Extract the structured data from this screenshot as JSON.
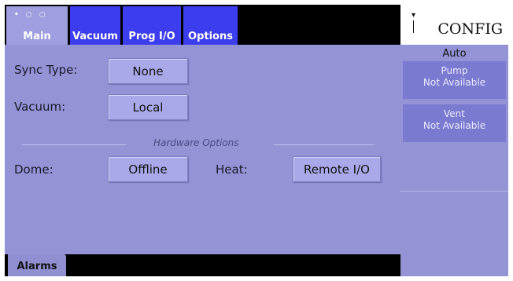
{
  "tabs": [
    {
      "label": "Main",
      "active": true
    },
    {
      "label": "Vacuum",
      "active": false
    },
    {
      "label": "Prog I/O",
      "active": false
    },
    {
      "label": "Options",
      "active": false
    }
  ],
  "tab_indicator": "• ○ ○",
  "main": {
    "sync_type": {
      "label": "Sync Type:",
      "value": "None"
    },
    "vacuum": {
      "label": "Vacuum:",
      "value": "Local"
    },
    "hardware_options_title": "Hardware Options",
    "dome": {
      "label": "Dome:",
      "value": "Offline"
    },
    "heat": {
      "label": "Heat:",
      "value": "Remote I/O"
    }
  },
  "bottom": {
    "alarms_label": "Alarms"
  },
  "side": {
    "mode_title": "CONFIG",
    "auto_label": "Auto",
    "pump": {
      "line1": "Pump",
      "line2": "Not Available"
    },
    "vent": {
      "line1": "Vent",
      "line2": "Not Available"
    }
  },
  "colors": {
    "tab_inactive": "#3d3df0",
    "tab_active": "#9e9ee0",
    "panel": "#9393d6",
    "button": "#a9a9ea",
    "side_button": "#7a7ad0"
  },
  "icons": {
    "dropdown": "chevron-down-icon"
  }
}
